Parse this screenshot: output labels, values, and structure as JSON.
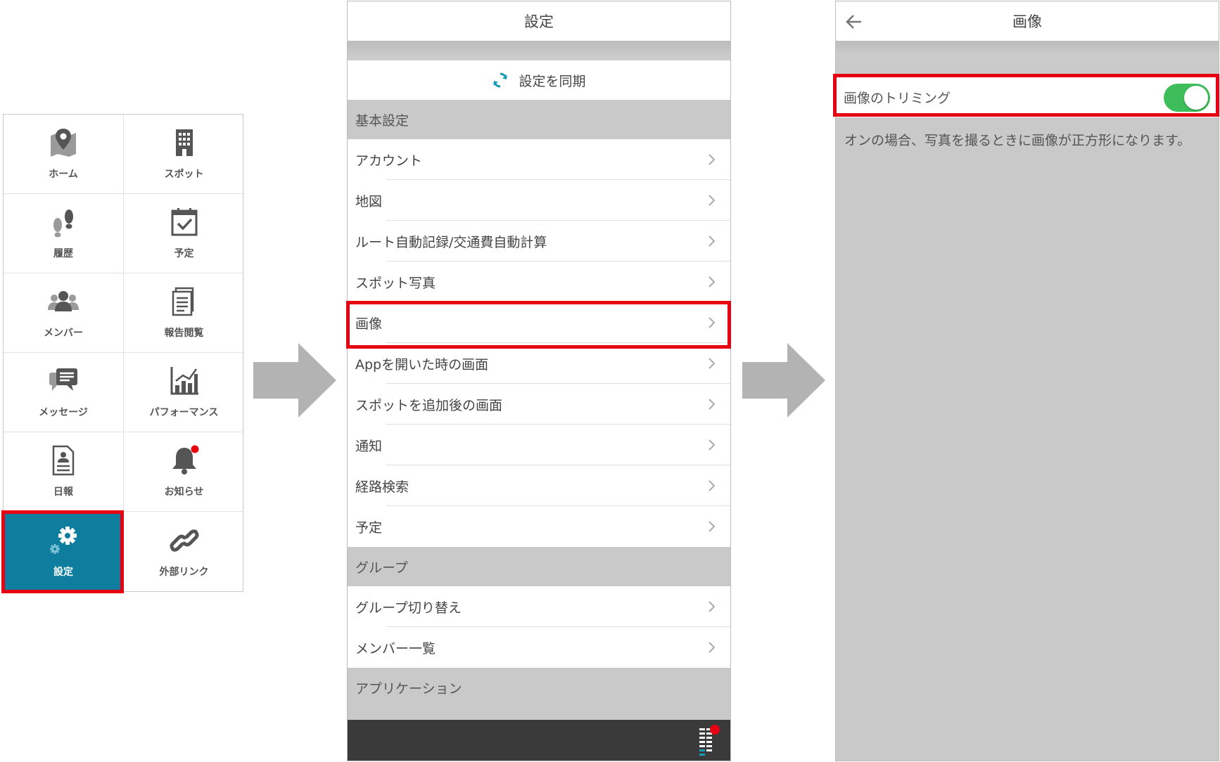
{
  "menu": {
    "tiles": [
      {
        "label": "ホーム",
        "icon": "map-pin-icon"
      },
      {
        "label": "スポット",
        "icon": "building-icon"
      },
      {
        "label": "履歴",
        "icon": "footprints-icon"
      },
      {
        "label": "予定",
        "icon": "calendar-check-icon"
      },
      {
        "label": "メンバー",
        "icon": "people-icon"
      },
      {
        "label": "報告閲覧",
        "icon": "documents-icon"
      },
      {
        "label": "メッセージ",
        "icon": "chat-icon"
      },
      {
        "label": "パフォーマンス",
        "icon": "bar-chart-icon"
      },
      {
        "label": "日報",
        "icon": "report-icon"
      },
      {
        "label": "お知らせ",
        "icon": "bell-icon"
      },
      {
        "label": "設定",
        "icon": "gear-icon"
      },
      {
        "label": "外部リンク",
        "icon": "link-icon"
      }
    ],
    "active_tile": "設定"
  },
  "settings": {
    "title": "設定",
    "sync_label": "設定を同期",
    "sections": [
      {
        "header": "基本設定",
        "items": [
          "アカウント",
          "地図",
          "ルート自動記録/交通費自動計算",
          "スポット写真",
          "画像",
          "Appを開いた時の画面",
          "スポットを追加後の画面",
          "通知",
          "経路検索",
          "予定"
        ]
      },
      {
        "header": "グループ",
        "items": [
          "グループ切り替え",
          "メンバー一覧"
        ]
      },
      {
        "header": "アプリケーション",
        "items": []
      }
    ],
    "highlighted_item": "画像"
  },
  "image_settings": {
    "title": "画像",
    "toggle_label": "画像のトリミング",
    "toggle_on": true,
    "description": "オンの場合、写真を撮るときに画像が正方形になります。"
  },
  "colors": {
    "highlight": "#e60012",
    "active_tile": "#0e7d9e",
    "toggle_on": "#3dbe5b",
    "arrow": "#b3b3b3"
  }
}
